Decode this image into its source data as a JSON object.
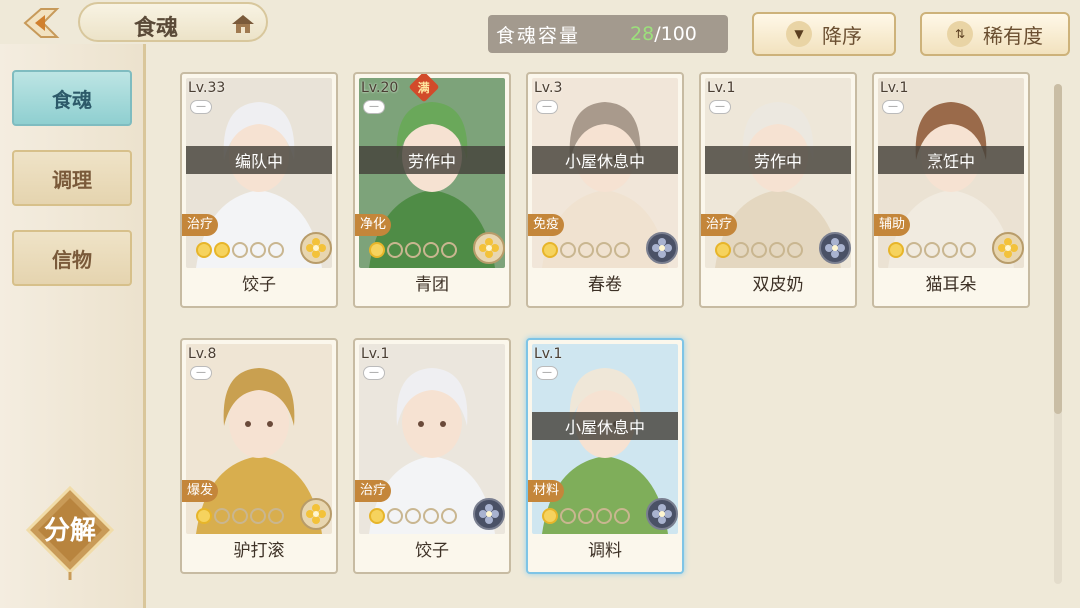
{
  "header": {
    "title": "食魂",
    "capacity_label": "食魂容量",
    "capacity_current": "28",
    "capacity_max": "/100",
    "sort_order_label": "降序",
    "sort_key_label": "稀有度"
  },
  "sidebar": {
    "tabs": [
      {
        "label": "食魂",
        "active": true
      },
      {
        "label": "调理",
        "active": false
      },
      {
        "label": "信物",
        "active": false
      }
    ],
    "decompose_label": "分解"
  },
  "cards": [
    {
      "level": "Lv.33",
      "status": "编队中",
      "role": "治疗",
      "stars": 2,
      "name": "饺子",
      "element": "light",
      "bg": "#e9e3d8",
      "hair": "#efeff2",
      "outfit": "#f3f4f6"
    },
    {
      "level": "Lv.20",
      "status": "劳作中",
      "role": "净化",
      "stars": 1,
      "name": "青团",
      "element": "light",
      "bg": "#7da37a",
      "hair": "#6aa85a",
      "outfit": "#4f8c46",
      "full": "满"
    },
    {
      "level": "Lv.3",
      "status": "小屋休息中",
      "role": "免疫",
      "stars": 1,
      "name": "春卷",
      "element": "dark",
      "bg": "#f1e6d9",
      "hair": "#a99a8c",
      "outfit": "#f0e2d0"
    },
    {
      "level": "Lv.1",
      "status": "劳作中",
      "role": "治疗",
      "stars": 1,
      "name": "双皮奶",
      "element": "dark",
      "bg": "#eee7d9",
      "hair": "#ece8e0",
      "outfit": "#e4d7c0"
    },
    {
      "level": "Lv.1",
      "status": "烹饪中",
      "role": "辅助",
      "stars": 1,
      "name": "猫耳朵",
      "element": "light",
      "bg": "#ebe2d3",
      "hair": "#9a6a4a",
      "outfit": "#f1ebe0"
    },
    {
      "level": "Lv.8",
      "status": "",
      "role": "爆发",
      "stars": 1,
      "name": "驴打滚",
      "element": "light",
      "bg": "#efe5d4",
      "hair": "#c9a050",
      "outfit": "#d8ae4e"
    },
    {
      "level": "Lv.1",
      "status": "",
      "role": "治疗",
      "stars": 1,
      "name": "饺子",
      "element": "dark",
      "bg": "#ebe6dd",
      "hair": "#efeff2",
      "outfit": "#f3f4f6"
    },
    {
      "level": "Lv.1",
      "status": "小屋休息中",
      "role": "材料",
      "stars": 1,
      "name": "调料",
      "element": "dark",
      "bg": "#cfe6f0",
      "hair": "#efe7d8",
      "outfit": "#7fae5a",
      "selected": true
    }
  ]
}
